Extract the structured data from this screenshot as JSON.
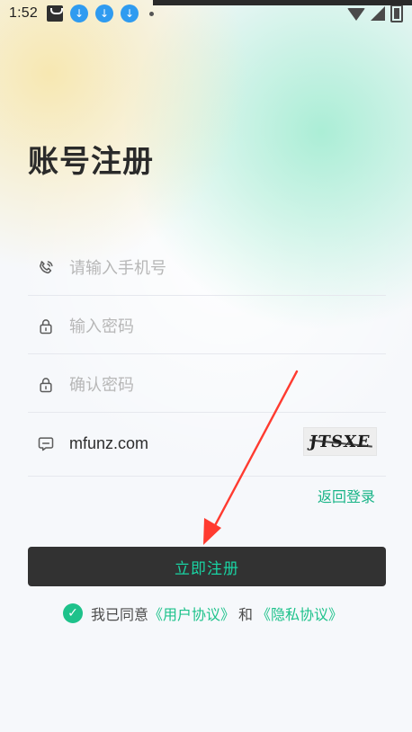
{
  "status_bar": {
    "time": "1:52",
    "icons_left": [
      "bag-icon",
      "download-icon",
      "download-icon",
      "download-icon",
      "dot-icon"
    ],
    "icons_right": [
      "wifi-icon",
      "signal-icon",
      "battery-icon"
    ]
  },
  "page": {
    "title": "账号注册"
  },
  "form": {
    "phone": {
      "icon": "phone-icon",
      "placeholder": "请输入手机号",
      "value": ""
    },
    "password": {
      "icon": "lock-icon",
      "placeholder": "输入密码",
      "value": ""
    },
    "confirm_password": {
      "icon": "lock-icon",
      "placeholder": "确认密码",
      "value": ""
    },
    "captcha": {
      "icon": "captcha-icon",
      "value": "mfunz.com",
      "image_text": "JTSXE"
    }
  },
  "actions": {
    "back_login_label": "返回登录",
    "submit_label": "立即注册"
  },
  "agreement": {
    "checked": true,
    "prefix": "我已同意",
    "user_agreement": "《用户协议》",
    "and": "和",
    "privacy_agreement": "《隐私协议》"
  },
  "colors": {
    "accent": "#1ec28b",
    "button_bg": "#323232",
    "button_text": "#1ad3a3",
    "annotation_arrow": "#ff3b30"
  }
}
